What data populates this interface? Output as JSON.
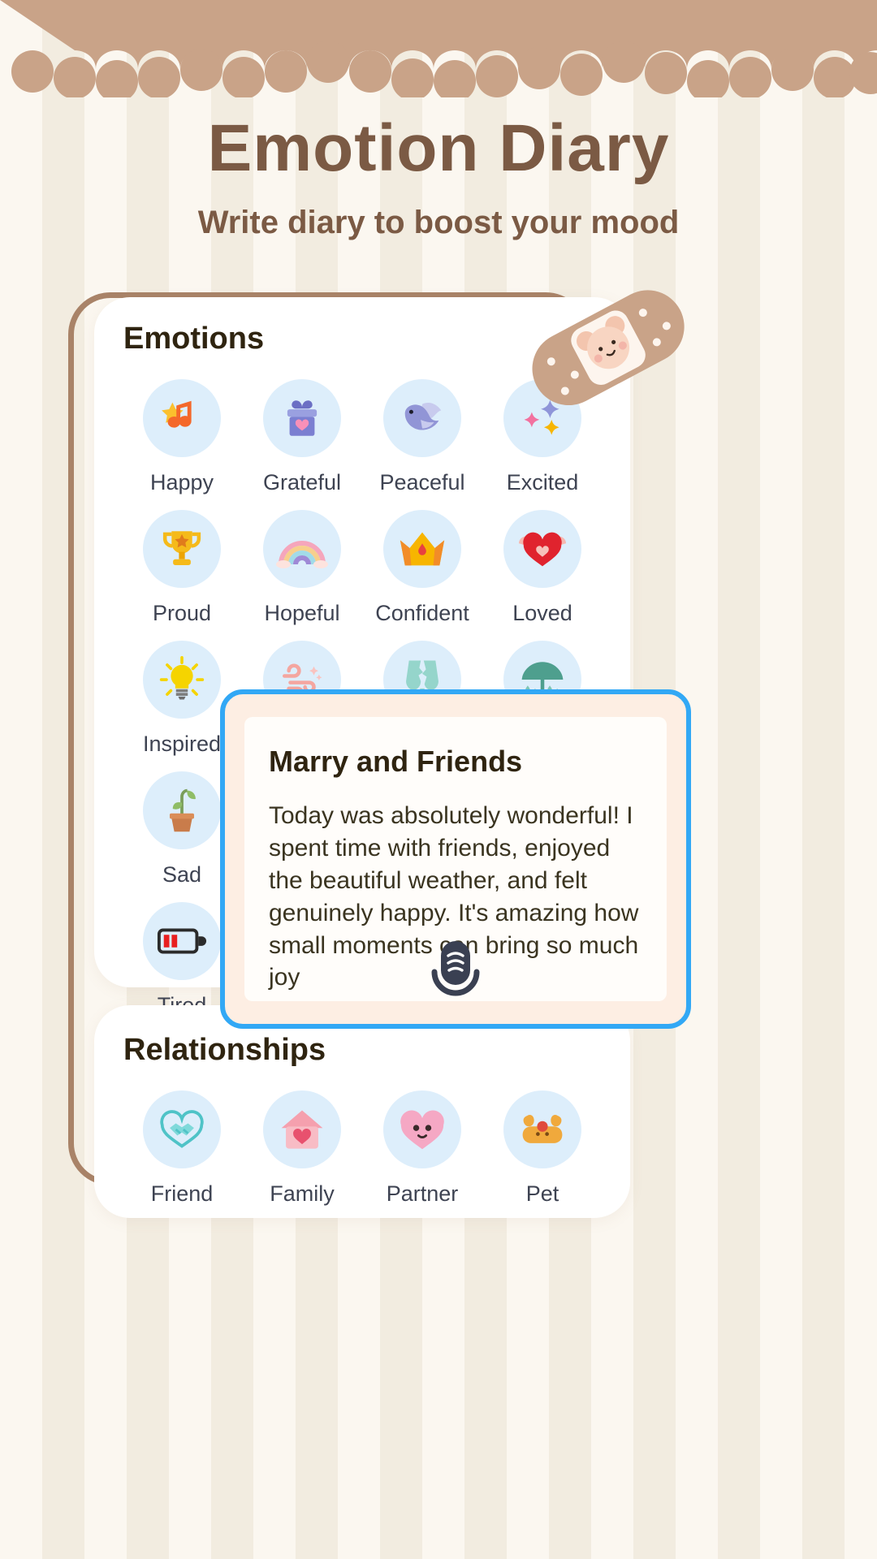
{
  "header": {
    "title": "Emotion Diary",
    "subtitle": "Write diary to boost your mood"
  },
  "colors": {
    "brand_brown": "#7b5a44",
    "panel_border": "#a98368",
    "scallop": "#c9a388",
    "bubble_bg": "#ddeefb",
    "modal_accent": "#32a8f5",
    "modal_bg": "#fdeee3"
  },
  "emotions_section": {
    "title": "Emotions",
    "items": [
      {
        "label": "Happy",
        "icon": "star-music-note-icon"
      },
      {
        "label": "Grateful",
        "icon": "gift-box-heart-icon"
      },
      {
        "label": "Peaceful",
        "icon": "dove-icon"
      },
      {
        "label": "Excited",
        "icon": "sparkles-icon"
      },
      {
        "label": "Proud",
        "icon": "trophy-icon"
      },
      {
        "label": "Hopeful",
        "icon": "rainbow-icon"
      },
      {
        "label": "Confident",
        "icon": "crown-icon"
      },
      {
        "label": "Loved",
        "icon": "winged-heart-icon"
      },
      {
        "label": "Inspired",
        "icon": "lightbulb-icon"
      },
      {
        "label": "",
        "icon": "wind-swirl-icon"
      },
      {
        "label": "",
        "icon": "broken-glass-icon"
      },
      {
        "label": "",
        "icon": "rain-umbrella-icon"
      },
      {
        "label": "Sad",
        "icon": "wilted-plant-icon"
      },
      {
        "label": "",
        "icon": ""
      },
      {
        "label": "",
        "icon": ""
      },
      {
        "label": "",
        "icon": ""
      },
      {
        "label": "Tired",
        "icon": "low-battery-icon"
      },
      {
        "label": "",
        "icon": ""
      },
      {
        "label": "",
        "icon": ""
      },
      {
        "label": "",
        "icon": ""
      }
    ]
  },
  "relationships_section": {
    "title": "Relationships",
    "items": [
      {
        "label": "Friend",
        "icon": "handshake-heart-icon"
      },
      {
        "label": "Family",
        "icon": "house-heart-icon"
      },
      {
        "label": "Partner",
        "icon": "couple-heart-icon"
      },
      {
        "label": "Pet",
        "icon": "dog-icon"
      }
    ]
  },
  "diary_modal": {
    "title": "Marry and Friends",
    "body": "Today was absolutely wonderful! I spent time with friends, enjoyed the beautiful weather, and felt genuinely happy. It's amazing how small moments can bring so much joy",
    "mic_icon": "microphone-icon"
  },
  "decoration": {
    "bandaid_icon": "bandaid-bear-icon",
    "scallop_icon": "cloud-scallop-border"
  }
}
